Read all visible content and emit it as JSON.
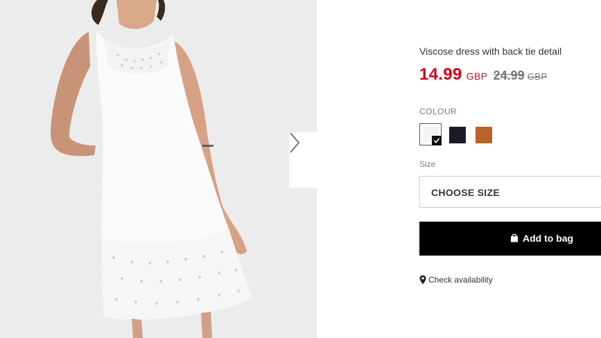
{
  "product": {
    "title": "Viscose dress with back tie detail",
    "price_now": "14.99",
    "currency_now": "GBP",
    "price_old": "24.99",
    "currency_old": "GBP"
  },
  "colour": {
    "label": "COLOUR",
    "swatches": [
      {
        "name": "white",
        "color": "#f2f2f2",
        "selected": true
      },
      {
        "name": "black",
        "color": "#1c1c26",
        "selected": false
      },
      {
        "name": "brown",
        "color": "#b9622a",
        "selected": false
      }
    ]
  },
  "size": {
    "label": "Size",
    "placeholder": "CHOOSE SIZE"
  },
  "actions": {
    "add_to_bag": "Add to bag",
    "check_availability": "Check availability"
  },
  "gallery": {
    "next_icon": "chevron-right-icon"
  }
}
